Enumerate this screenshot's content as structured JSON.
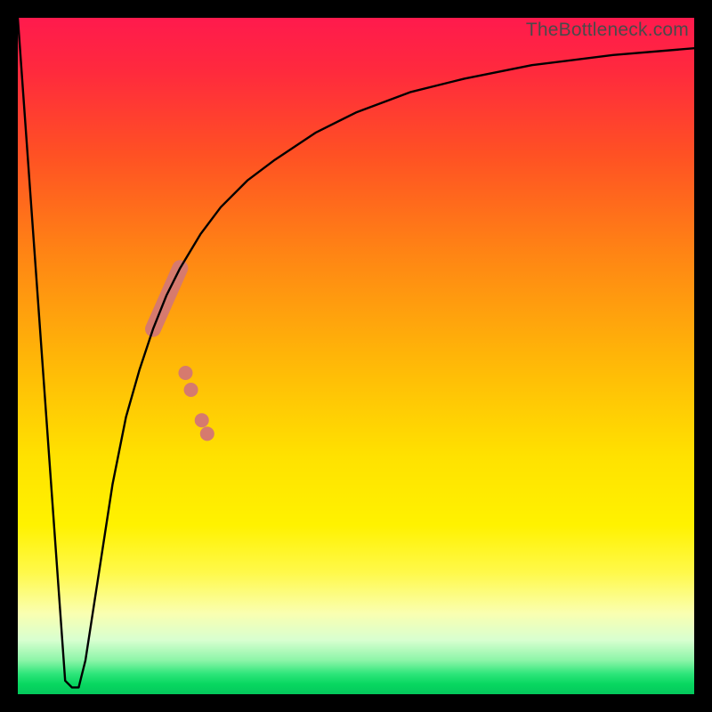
{
  "watermark": "TheBottleneck.com",
  "chart_data": {
    "type": "line",
    "title": "",
    "xlabel": "",
    "ylabel": "",
    "xlim": [
      0,
      100
    ],
    "ylim": [
      0,
      100
    ],
    "grid": false,
    "legend": false,
    "series": [
      {
        "name": "bottleneck-curve",
        "x": [
          0,
          2,
          4,
          6,
          7,
          8,
          9,
          10,
          12,
          14,
          16,
          18,
          20,
          22,
          24,
          27,
          30,
          34,
          38,
          44,
          50,
          58,
          66,
          76,
          88,
          100
        ],
        "y": [
          100,
          72,
          44,
          16,
          2,
          1,
          1,
          5,
          18,
          31,
          41,
          48,
          54,
          59,
          63,
          68,
          72,
          76,
          79,
          83,
          86,
          89,
          91,
          93,
          94.5,
          95.5
        ]
      }
    ],
    "markers": [
      {
        "name": "highlight-cluster-upper",
        "shape": "segment",
        "color": "#d67a6e",
        "x_start": 20,
        "y_start": 54,
        "x_end": 24,
        "y_end": 63,
        "width": 18
      },
      {
        "name": "highlight-dot-1",
        "shape": "circle",
        "color": "#d67a6e",
        "x": 24.8,
        "y": 47.5,
        "r": 8
      },
      {
        "name": "highlight-dot-2",
        "shape": "circle",
        "color": "#d67a6e",
        "x": 25.6,
        "y": 45,
        "r": 8
      },
      {
        "name": "highlight-dot-3",
        "shape": "circle",
        "color": "#d67a6e",
        "x": 27.2,
        "y": 40.5,
        "r": 8
      },
      {
        "name": "highlight-dot-4",
        "shape": "circle",
        "color": "#d67a6e",
        "x": 28.0,
        "y": 38.5,
        "r": 8
      }
    ]
  }
}
